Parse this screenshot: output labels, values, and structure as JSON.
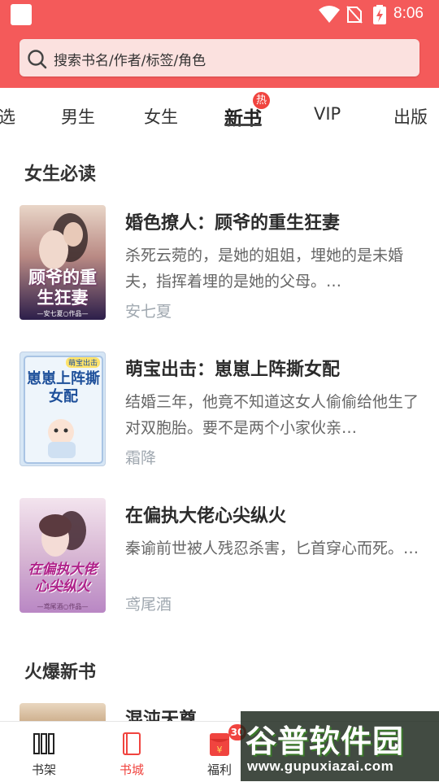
{
  "status_bar": {
    "time": "8:06"
  },
  "search": {
    "placeholder": "搜索书名/作者/标签/角色"
  },
  "tabs": [
    {
      "label": "选"
    },
    {
      "label": "男生"
    },
    {
      "label": "女生"
    },
    {
      "label": "新书",
      "active": true,
      "badge": "热"
    },
    {
      "label": "VIP"
    },
    {
      "label": "出版"
    }
  ],
  "sections": [
    {
      "title": "女生必读",
      "books": [
        {
          "title": "婚色撩人：顾爷的重生狂妻",
          "description": "杀死云菀的，是她的姐姐，埋她的是未婚夫，指挥着埋的是她的父母。…",
          "author": "安七夏",
          "cover_text": "顾爷的重生狂妻",
          "cover_caption": "—安七夏○作品—"
        },
        {
          "title": "萌宝出击：崽崽上阵撕女配",
          "description": "结婚三年，他竟不知道这女人偷偷给他生了对双胞胎。要不是两个小家伙亲…",
          "author": "霜降",
          "cover_text": "崽崽上阵撕女配",
          "cover_caption": "萌宝出击"
        },
        {
          "title": "在偏执大佬心尖纵火",
          "description": "秦谕前世被人残忍杀害，匕首穿心而死。…",
          "author": "鸢尾酒",
          "cover_text": "在偏执大佬心尖纵火",
          "cover_caption": "—鸢尾酒○作品—"
        }
      ]
    },
    {
      "title": "火爆新书",
      "books": [
        {
          "title": "混沌天尊"
        }
      ]
    }
  ],
  "bottom_nav": [
    {
      "label": "书架",
      "icon": "bookshelf-icon"
    },
    {
      "label": "书城",
      "icon": "book-icon",
      "active": true
    },
    {
      "label": "福利",
      "icon": "red-envelope-icon",
      "badge": "30"
    }
  ],
  "watermark": {
    "brand": "谷普软件园",
    "url": "www.gupuxiazai.com"
  },
  "colors": {
    "accent": "#f45a5a",
    "search_bg": "#fbe1df",
    "active_red": "#f0443f"
  }
}
